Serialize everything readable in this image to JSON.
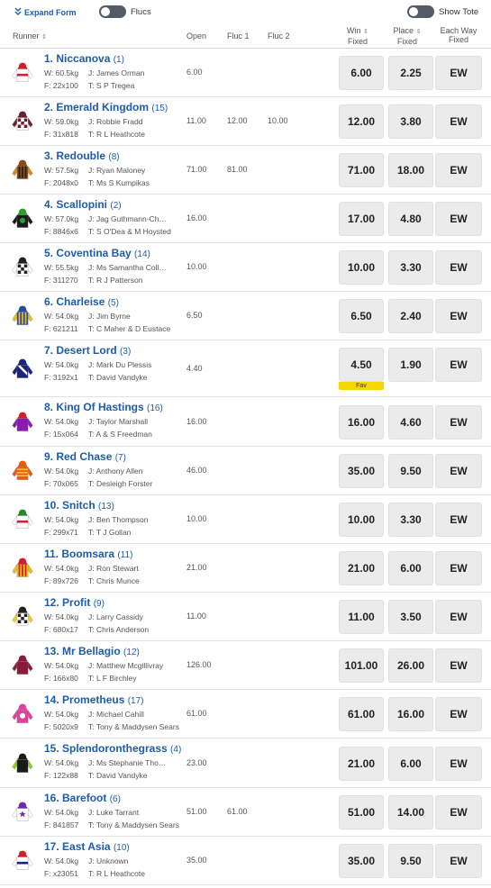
{
  "topbar": {
    "expand_label": "Expand Form",
    "flucs_label": "Flucs",
    "tote_label": "Show Tote"
  },
  "header": {
    "runner": "Runner",
    "open": "Open",
    "fluc1": "Fluc 1",
    "fluc2": "Fluc 2",
    "win_line1": "Win",
    "win_line2": "Fixed",
    "place_line1": "Place",
    "place_line2": "Fixed",
    "ew_line1": "Each Way",
    "ew_line2": "Fixed"
  },
  "runners": [
    {
      "name": "1. Niccanova",
      "barrier": "(1)",
      "weight": "W: 60.5kg",
      "jockey": "J: James Orman",
      "form": "F: 22x100",
      "trainer": "T: S P Tregea",
      "open": "6.00",
      "fluc1": "",
      "fluc2": "",
      "win": "6.00",
      "place": "2.25",
      "ew": "EW",
      "fav": "",
      "silk": {
        "body": "#ffffff",
        "sleeve": "#ffffff",
        "cap": "#d0202a",
        "accent": "#d0202a",
        "pattern": "band"
      }
    },
    {
      "name": "2. Emerald Kingdom",
      "barrier": "(15)",
      "weight": "W: 59.0kg",
      "jockey": "J: Robbie Fradd",
      "form": "F: 31x818",
      "trainer": "T: R L Heathcote",
      "open": "11.00",
      "fluc1": "12.00",
      "fluc2": "10.00",
      "win": "12.00",
      "place": "3.80",
      "ew": "EW",
      "fav": "",
      "silk": {
        "body": "#ffffff",
        "sleeve": "#6a1f2e",
        "cap": "#6a1f2e",
        "accent": "#6a1f2e",
        "pattern": "check"
      }
    },
    {
      "name": "3. Redouble",
      "barrier": "(8)",
      "weight": "W: 57.5kg",
      "jockey": "J: Ryan Maloney",
      "form": "F: 2048x0",
      "trainer": "T: Ms S Kumpikas",
      "open": "71.00",
      "fluc1": "81.00",
      "fluc2": "",
      "win": "71.00",
      "place": "18.00",
      "ew": "EW",
      "fav": "",
      "silk": {
        "body": "#8a4a12",
        "sleeve": "#d88a1a",
        "cap": "#8a4a12",
        "accent": "#222222",
        "pattern": "stripes"
      }
    },
    {
      "name": "4. Scallopini",
      "barrier": "(2)",
      "weight": "W: 57.0kg",
      "jockey": "J: Jag Guthmann-Ch…",
      "form": "F: 8846x6",
      "trainer": "T: S O'Dea & M Hoysted",
      "open": "16.00",
      "fluc1": "",
      "fluc2": "",
      "win": "17.00",
      "place": "4.80",
      "ew": "EW",
      "fav": "",
      "silk": {
        "body": "#1a1a1a",
        "sleeve": "#1a1a1a",
        "cap": "#2aa02a",
        "accent": "#2aa02a",
        "pattern": "spot"
      }
    },
    {
      "name": "5. Coventina Bay",
      "barrier": "(14)",
      "weight": "W: 55.5kg",
      "jockey": "J: Ms Samantha Coll…",
      "form": "F: 311270",
      "trainer": "T: R J Patterson",
      "open": "10.00",
      "fluc1": "",
      "fluc2": "",
      "win": "10.00",
      "place": "3.30",
      "ew": "EW",
      "fav": "",
      "silk": {
        "body": "#ffffff",
        "sleeve": "#ffffff",
        "cap": "#222222",
        "accent": "#222222",
        "pattern": "check"
      }
    },
    {
      "name": "6. Charleise",
      "barrier": "(5)",
      "weight": "W: 54.0kg",
      "jockey": "J: Jim Byrne",
      "form": "F: 621211",
      "trainer": "T: C Maher & D Eustace",
      "open": "6.50",
      "fluc1": "",
      "fluc2": "",
      "win": "6.50",
      "place": "2.40",
      "ew": "EW",
      "fav": "",
      "silk": {
        "body": "#2a4aa0",
        "sleeve": "#e8c020",
        "cap": "#2a4aa0",
        "accent": "#e8c020",
        "pattern": "stripes"
      }
    },
    {
      "name": "7. Desert Lord",
      "barrier": "(3)",
      "weight": "W: 54.0kg",
      "jockey": "J: Mark Du Plessis",
      "form": "F: 3192x1",
      "trainer": "T: David Vandyke",
      "open": "4.40",
      "fluc1": "",
      "fluc2": "",
      "win": "4.50",
      "place": "1.90",
      "ew": "EW",
      "fav": "Fav",
      "silk": {
        "body": "#1a237e",
        "sleeve": "#1a237e",
        "cap": "#1a237e",
        "accent": "#ffffff",
        "pattern": "sash"
      }
    },
    {
      "name": "8. King Of Hastings",
      "barrier": "(16)",
      "weight": "W: 54.0kg",
      "jockey": "J: Taylor Marshall",
      "form": "F: 15x064",
      "trainer": "T: A & S Freedman",
      "open": "16.00",
      "fluc1": "",
      "fluc2": "",
      "win": "16.00",
      "place": "4.60",
      "ew": "EW",
      "fav": "",
      "silk": {
        "body": "#8a1ab0",
        "sleeve": "#8a1ab0",
        "cap": "#d0202a",
        "accent": "#d0202a",
        "pattern": "plain"
      }
    },
    {
      "name": "9. Red Chase",
      "barrier": "(7)",
      "weight": "W: 54.0kg",
      "jockey": "J: Anthony Allen",
      "form": "F: 70x065",
      "trainer": "T: Desleigh Forster",
      "open": "46.00",
      "fluc1": "",
      "fluc2": "",
      "win": "35.00",
      "place": "9.50",
      "ew": "EW",
      "fav": "",
      "silk": {
        "body": "#e85a10",
        "sleeve": "#e85a10",
        "cap": "#e85a10",
        "accent": "#f2c040",
        "pattern": "hoops"
      }
    },
    {
      "name": "10. Snitch",
      "barrier": "(13)",
      "weight": "W: 54.0kg",
      "jockey": "J: Ben Thompson",
      "form": "F: 299x71",
      "trainer": "T: T J Gollan",
      "open": "10.00",
      "fluc1": "",
      "fluc2": "",
      "win": "10.00",
      "place": "3.30",
      "ew": "EW",
      "fav": "",
      "silk": {
        "body": "#ffffff",
        "sleeve": "#ffffff",
        "cap": "#2a8a2a",
        "accent": "#d0202a",
        "pattern": "band"
      }
    },
    {
      "name": "11. Boomsara",
      "barrier": "(11)",
      "weight": "W: 54.0kg",
      "jockey": "J: Ron Stewart",
      "form": "F: 89x726",
      "trainer": "T: Chris Munce",
      "open": "21.00",
      "fluc1": "",
      "fluc2": "",
      "win": "21.00",
      "place": "6.00",
      "ew": "EW",
      "fav": "",
      "silk": {
        "body": "#e8c020",
        "sleeve": "#e8c020",
        "cap": "#d0202a",
        "accent": "#d0202a",
        "pattern": "stripes"
      }
    },
    {
      "name": "12. Profit",
      "barrier": "(9)",
      "weight": "W: 54.0kg",
      "jockey": "J: Larry Cassidy",
      "form": "F: 680x17",
      "trainer": "T: Chris Anderson",
      "open": "11.00",
      "fluc1": "",
      "fluc2": "",
      "win": "11.00",
      "place": "3.50",
      "ew": "EW",
      "fav": "",
      "silk": {
        "body": "#ffffff",
        "sleeve": "#e8d020",
        "cap": "#222222",
        "accent": "#222222",
        "pattern": "check"
      }
    },
    {
      "name": "13. Mr Bellagio",
      "barrier": "(12)",
      "weight": "W: 54.0kg",
      "jockey": "J: Matthew Mcgillivray",
      "form": "F: 166x80",
      "trainer": "T: L F Birchley",
      "open": "126.00",
      "fluc1": "",
      "fluc2": "",
      "win": "101.00",
      "place": "26.00",
      "ew": "EW",
      "fav": "",
      "silk": {
        "body": "#8a1a3a",
        "sleeve": "#8a1a3a",
        "cap": "#8a1a3a",
        "accent": "#ffffff",
        "pattern": "plain"
      }
    },
    {
      "name": "14. Prometheus",
      "barrier": "(17)",
      "weight": "W: 54.0kg",
      "jockey": "J: Michael Cahill",
      "form": "F: 5020x9",
      "trainer": "T: Tony & Maddysen Sears",
      "open": "61.00",
      "fluc1": "",
      "fluc2": "",
      "win": "61.00",
      "place": "16.00",
      "ew": "EW",
      "fav": "",
      "silk": {
        "body": "#e040a0",
        "sleeve": "#e040a0",
        "cap": "#e040a0",
        "accent": "#ffffff",
        "pattern": "spot"
      }
    },
    {
      "name": "15. Splendoronthegrass",
      "barrier": "(4)",
      "weight": "W: 54.0kg",
      "jockey": "J: Ms Stephanie Tho…",
      "form": "F: 122x88",
      "trainer": "T: David Vandyke",
      "open": "23.00",
      "fluc1": "",
      "fluc2": "",
      "win": "21.00",
      "place": "6.00",
      "ew": "EW",
      "fav": "",
      "silk": {
        "body": "#1a1a1a",
        "sleeve": "#8ad020",
        "cap": "#1a1a1a",
        "accent": "#8ad020",
        "pattern": "plain"
      }
    },
    {
      "name": "16. Barefoot",
      "barrier": "(6)",
      "weight": "W: 54.0kg",
      "jockey": "J: Luke Tarrant",
      "form": "F: 841857",
      "trainer": "T: Tony & Maddysen Sears",
      "open": "51.00",
      "fluc1": "61.00",
      "fluc2": "",
      "win": "51.00",
      "place": "14.00",
      "ew": "EW",
      "fav": "",
      "silk": {
        "body": "#ffffff",
        "sleeve": "#ffffff",
        "cap": "#6a2ab0",
        "accent": "#6a2ab0",
        "pattern": "star"
      }
    },
    {
      "name": "17. East Asia",
      "barrier": "(10)",
      "weight": "W: 54.0kg",
      "jockey": "J: Unknown",
      "form": "F: x23051",
      "trainer": "T: R L Heathcote",
      "open": "35.00",
      "fluc1": "",
      "fluc2": "",
      "win": "35.00",
      "place": "9.50",
      "ew": "EW",
      "fav": "",
      "silk": {
        "body": "#ffffff",
        "sleeve": "#ffffff",
        "cap": "#d0202a",
        "accent": "#1a237e",
        "pattern": "band"
      }
    }
  ]
}
